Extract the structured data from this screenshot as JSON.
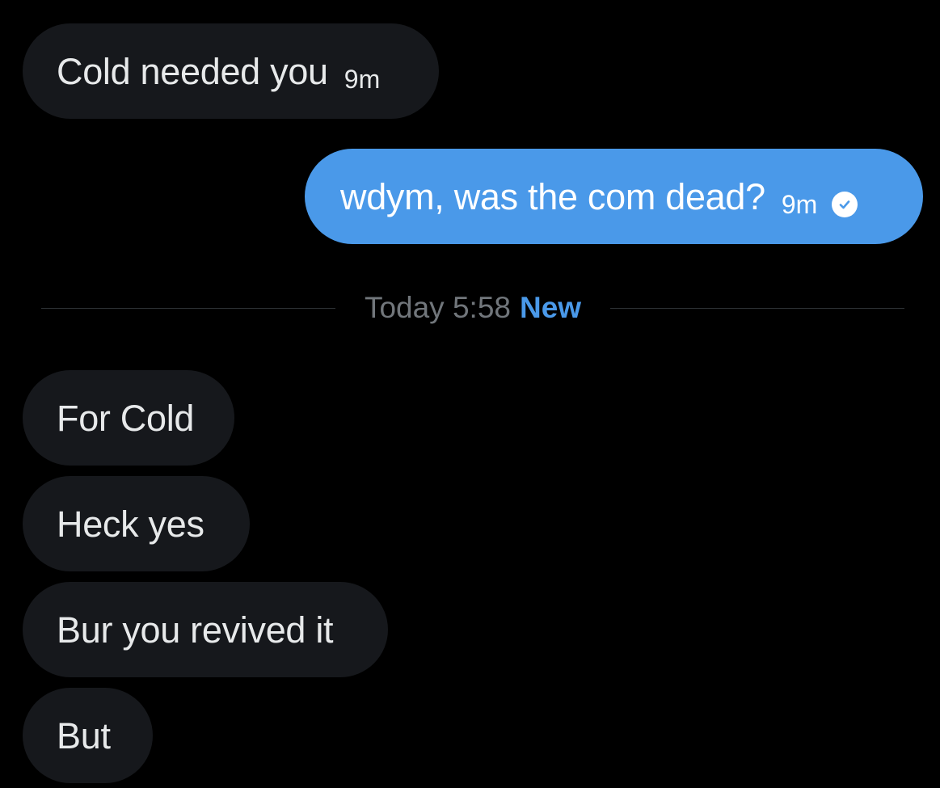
{
  "theme": {
    "background": "#000000",
    "incoming_bubble": "#16181c",
    "outgoing_bubble": "#4a99e9",
    "text_primary": "#e7e9ea",
    "text_muted": "#71767b",
    "accent": "#4a99e9"
  },
  "conversation": {
    "earlier": [
      {
        "direction": "incoming",
        "text": "Cold needed you",
        "time": "9m"
      },
      {
        "direction": "outgoing",
        "text": "wdym, was the com dead?",
        "time": "9m",
        "status_icon": "read-check-icon"
      }
    ],
    "divider": {
      "date_label": "Today 5:58",
      "new_label": "New"
    },
    "recent": [
      {
        "direction": "incoming",
        "text": "For Cold"
      },
      {
        "direction": "incoming",
        "text": "Heck yes"
      },
      {
        "direction": "incoming",
        "text": "Bur you revived it"
      },
      {
        "direction": "incoming",
        "text": "But"
      }
    ]
  }
}
